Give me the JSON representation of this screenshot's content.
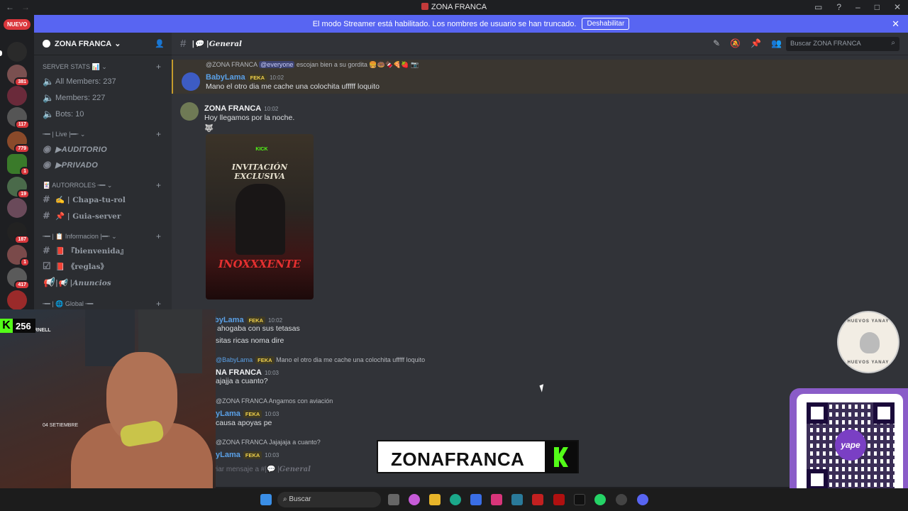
{
  "window": {
    "title": "ZONA FRANCA"
  },
  "banner": {
    "text": "El modo Streamer está habilitado. Los nombres de usuario se han truncado.",
    "button": "Deshabilitar"
  },
  "guilds": {
    "new_label": "NUEVO",
    "badges": [
      "381",
      "117",
      "779",
      "1",
      "19",
      "187",
      "1",
      "417"
    ]
  },
  "sidebar": {
    "server_name": "ZONA FRANCA",
    "categories": [
      {
        "label": "SERVER STATS 📊"
      },
      {
        "label": "╼━ | Live |━╾"
      },
      {
        "label": "🃏 AUTORROLES ╼━"
      },
      {
        "label": "╼━ | 📋 Informacion |━╾"
      },
      {
        "label": "╼━ | 🌐 Global ╼━"
      }
    ],
    "channels": [
      {
        "label": "All Members: 237"
      },
      {
        "label": "Members: 227"
      },
      {
        "label": "Bots: 10"
      },
      {
        "label": "▶AUDITORIO"
      },
      {
        "label": "▶PRIVADO"
      },
      {
        "label": "✍️ | Chapa-tu-rol"
      },
      {
        "label": "📌 | Guia-server"
      },
      {
        "label": "📕 『bienvenida』"
      },
      {
        "label": "📕 《reglas》"
      },
      {
        "label": "|📢 |Anuncios"
      }
    ]
  },
  "channel_header": {
    "name": "|💬 |General",
    "search_placeholder": "Buscar ZONA FRANCA"
  },
  "messages": [
    {
      "reply_author": "@ZONA FRANCA",
      "reply_mention": "@everyone",
      "reply_text": "escojan bien a su gordita 🍔🍩🍫🍕🍓 📷",
      "author": "BabyLama",
      "tag": "FEKA",
      "time": "10:02",
      "body": "Mano el otro dia me cache una colochita ufffff loquito"
    },
    {
      "author": "ZONA FRANCA",
      "time": "10:02",
      "body": "Hoy llegamos por la noche.",
      "emoji": "🐺"
    },
    {
      "author": "byLama",
      "tag": "FEKA",
      "time": "10:02",
      "body1": "ahogaba con sus tetasas",
      "body2": "sitas ricas noma dire"
    },
    {
      "reply_author": "@BabyLama",
      "reply_tag": "FEKA",
      "reply_text": "Mano el otro dia me cache una colochita ufffff loquito",
      "author": "NA FRANCA",
      "time": "10:03",
      "body": "ajajja a cuanto?"
    },
    {
      "reply_author": "@ZONA FRANCA",
      "reply_text": "Angamos con aviación",
      "author": "yLama",
      "tag": "FEKA",
      "time": "10:03",
      "body": "causa apoyas pe"
    },
    {
      "reply_author": "@ZONA FRANCA",
      "reply_text": "Jajajaja a cuanto?",
      "author": "yLama",
      "tag": "FEKA",
      "time": "10:03"
    }
  ],
  "poster": {
    "brand": "KICK",
    "line1": "INVITACIÓN EXCLUSIVA",
    "line2": "INOXXXENTE"
  },
  "composer": {
    "placeholder_prefix": "viar mensaje a #|💬 |",
    "placeholder_channel": "General"
  },
  "overlay": {
    "kick_viewers": "256",
    "brand_text": "ZONAFRANCA",
    "logo_top": "HUEVOS YANAY",
    "logo_bottom": "HUEVOS YANAY",
    "qr_label": "yape",
    "webcam_text1": "CHRIS CORNELL",
    "webcam_text2": "04 SETIEMBRE"
  },
  "taskbar": {
    "search": "Buscar"
  },
  "colors": {
    "accent": "#5865f2",
    "kick_green": "#53fc18",
    "mention_bg": "#3c4270",
    "highlight_border": "#c49b2c"
  }
}
